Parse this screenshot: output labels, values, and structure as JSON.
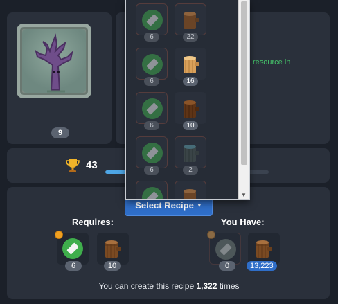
{
  "image_panel": {
    "level": "9"
  },
  "info_panel": {
    "fragment_text": "resource in"
  },
  "stats": {
    "trophy_value": "43",
    "progress": 0.84
  },
  "recipe": {
    "select_label": "Select Recipe",
    "requires_title": "Requires:",
    "you_have_title": "You Have:",
    "requires": [
      {
        "icon": "green-gem-icon",
        "count": "6"
      },
      {
        "icon": "wood-log-icon",
        "count": "10"
      }
    ],
    "you_have": [
      {
        "icon": "grey-gem-icon",
        "count": "0"
      },
      {
        "icon": "wood-log-icon",
        "count": "13,223"
      }
    ],
    "note_prefix": "You can create this recipe",
    "note_count": "1,322",
    "note_suffix": "times"
  },
  "dropdown": {
    "options": [
      {
        "gem_count": "6",
        "log_icon": "wood-log-icon",
        "log_count": "22"
      },
      {
        "gem_count": "6",
        "log_icon": "light-wood-log-icon",
        "log_count": "16"
      },
      {
        "gem_count": "6",
        "log_icon": "dark-wood-log-icon",
        "log_count": "10"
      },
      {
        "gem_count": "6",
        "log_icon": "teal-wood-log-icon",
        "log_count": "2"
      },
      {
        "gem_count": "",
        "log_icon": "wood-log-icon",
        "log_count": ""
      }
    ]
  },
  "colors": {
    "accent_blue": "#2f6ec8",
    "gem_green": "#3fae4c",
    "text_green": "#45c46a",
    "background": "#1b2029",
    "panel": "#2a303b"
  }
}
